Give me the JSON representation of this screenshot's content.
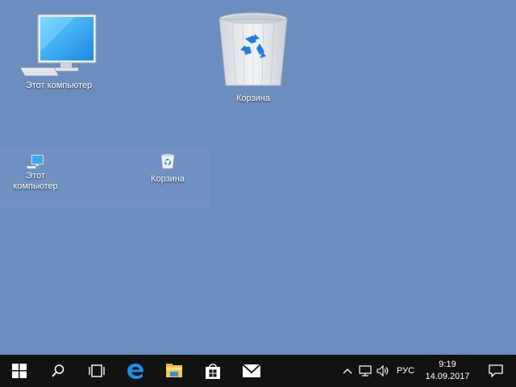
{
  "desktop": {
    "background": "#6c8ebf",
    "icons_large": [
      {
        "label": "Этот компьютер",
        "icon": "computer-icon"
      },
      {
        "label": "Корзина",
        "icon": "recycle-bin-icon"
      }
    ],
    "icons_small": [
      {
        "label": "Этот компьютер",
        "icon": "computer-icon"
      },
      {
        "label": "Корзина",
        "icon": "recycle-bin-icon"
      }
    ]
  },
  "taskbar": {
    "background": "#121212",
    "buttons": [
      {
        "icon": "windows-start-icon"
      },
      {
        "icon": "search-icon"
      },
      {
        "icon": "task-view-icon"
      },
      {
        "icon": "edge-browser-icon"
      },
      {
        "icon": "file-explorer-icon"
      },
      {
        "icon": "store-icon"
      },
      {
        "icon": "mail-icon"
      }
    ],
    "tray": {
      "chevron_icon": "chevron-up-icon",
      "network_icon": "network-icon",
      "volume_icon": "volume-icon",
      "language": "РУС",
      "time": "9:19",
      "date": "14.09.2017",
      "notification_icon": "action-center-icon"
    }
  }
}
